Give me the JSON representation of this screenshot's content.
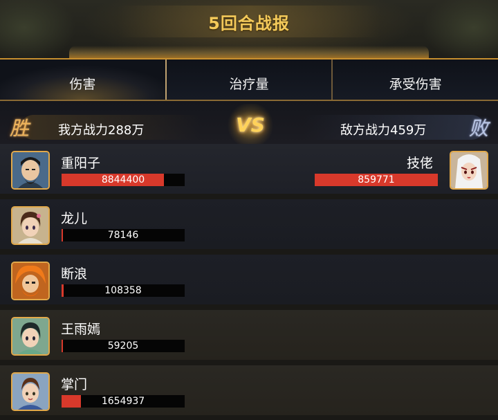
{
  "title": "5回合战报",
  "tabs": [
    {
      "label": "伤害",
      "active": true
    },
    {
      "label": "治疗量",
      "active": false
    },
    {
      "label": "承受伤害",
      "active": false
    }
  ],
  "versus": {
    "left_result": "胜",
    "right_result": "败",
    "left_power": "我方战力288万",
    "right_power": "敌方战力459万",
    "vs_label": "VS"
  },
  "allies": [
    {
      "name": "重阳子",
      "value": "8844400",
      "fill_fraction": 0.83
    },
    {
      "name": "龙儿",
      "value": "78146",
      "fill_fraction": 0.01
    },
    {
      "name": "断浪",
      "value": "108358",
      "fill_fraction": 0.015
    },
    {
      "name": "王雨嫣",
      "value": "59205",
      "fill_fraction": 0.01
    },
    {
      "name": "掌门",
      "value": "1654937",
      "fill_fraction": 0.16
    }
  ],
  "enemies": [
    {
      "name": "技佬",
      "value": "859771",
      "fill_fraction": 1.0
    }
  ],
  "colors": {
    "accent_gold": "#f3c95a",
    "damage_bar": "#d8392b",
    "avatar_border": "#e2a94a"
  }
}
